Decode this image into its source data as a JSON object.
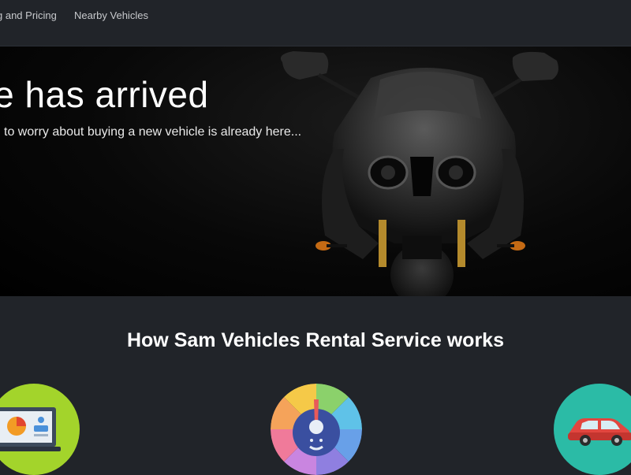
{
  "nav": {
    "links": [
      "g and Pricing",
      "Nearby Vehicles"
    ]
  },
  "hero": {
    "title": "ture has arrived",
    "subtitle": "'t have to worry about buying a new vehicle is already here..."
  },
  "how_it_works": {
    "title": "How Sam Vehicles Rental Service works",
    "step_icons": [
      "laptop-icon",
      "speedometer-icon",
      "car-icon"
    ]
  },
  "colors": {
    "background": "#212429",
    "hero_bg": "#000000",
    "icon1_bg": "#a3d42b",
    "icon3_bg": "#2bbba6"
  }
}
